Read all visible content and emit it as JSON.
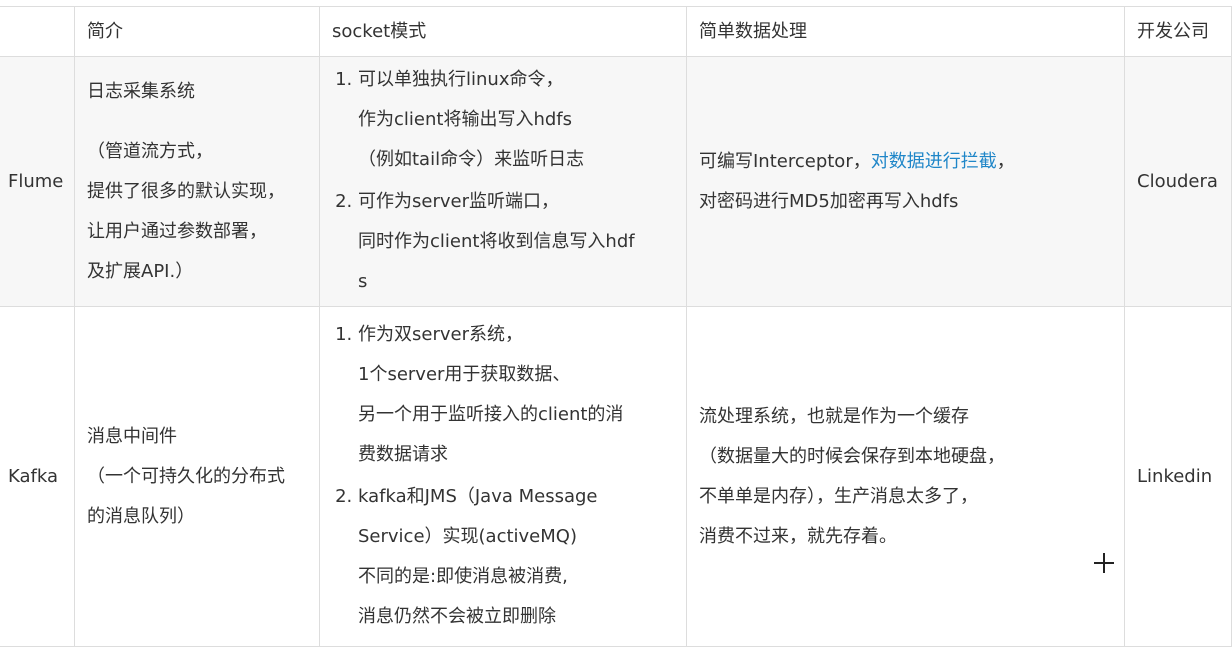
{
  "headers": [
    "",
    "简介",
    "socket模式",
    "简单数据处理",
    "开发公司"
  ],
  "rows": [
    {
      "name": "Flume",
      "intro": {
        "line1": "日志采集系统",
        "lines": [
          "（管道流方式，",
          "提供了很多的默认实现，",
          "让用户通过参数部署，",
          "及扩展API.）"
        ]
      },
      "socket": [
        [
          "可以单独执行linux命令，",
          "作为client将输出写入hdfs",
          "（例如tail命令）来监听日志"
        ],
        [
          "可作为server监听端口，",
          "同时作为client将收到信息写入hdf",
          "s"
        ]
      ],
      "processing": {
        "line1_before": "可编写Interceptor，",
        "line1_link": "对数据进行拦截",
        "line1_after": "，",
        "line2": "对密码进行MD5加密再写入hdfs"
      },
      "company": "Cloudera"
    },
    {
      "name": "Kafka",
      "intro": {
        "lines": [
          "消息中间件",
          "（一个可持久化的分布式",
          "的消息队列）"
        ]
      },
      "socket": [
        [
          "作为双server系统，",
          "1个server用于获取数据、",
          "另一个用于监听接入的client的消",
          "费数据请求"
        ],
        [
          "kafka和JMS（Java Message",
          "Service）实现(activeMQ)",
          "不同的是:即使消息被消费,",
          "消息仍然不会被立即删除"
        ]
      ],
      "processing": {
        "lines": [
          "流处理系统，也就是作为一个缓存",
          "（数据量大的时候会保存到本地硬盘，",
          "不单单是内存），生产消息太多了，",
          "消费不过来，就先存着。"
        ]
      },
      "company": "Linkedin"
    }
  ],
  "colors": {
    "link": "#1f86c8",
    "border": "#dddddd",
    "row_alt": "#f7f7f7",
    "text": "#333333"
  }
}
